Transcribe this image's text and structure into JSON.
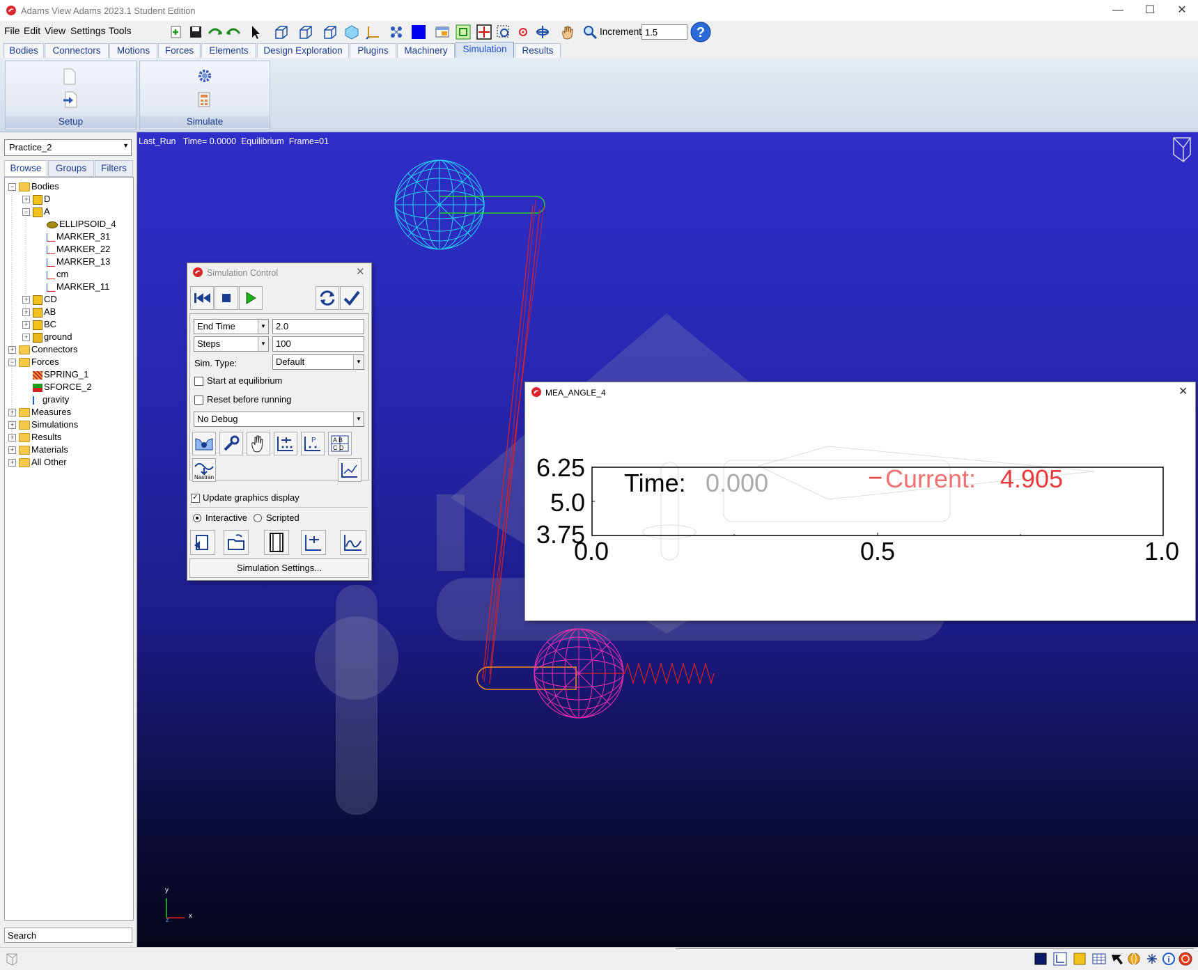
{
  "window": {
    "title": "Adams  View Adams 2023.1 Student Edition",
    "controls": [
      "—",
      "☐",
      "✕"
    ]
  },
  "menu": [
    "File",
    "Edit",
    "View",
    "Settings",
    "Tools"
  ],
  "toolbar": {
    "increment_label": "Increment",
    "increment_value": "1.5"
  },
  "ribbon_tabs": [
    "Bodies",
    "Connectors",
    "Motions",
    "Forces",
    "Elements",
    "Design Exploration",
    "Plugins",
    "Machinery",
    "Simulation",
    "Results"
  ],
  "active_tab": "Simulation",
  "ribbon_groups": [
    "Setup",
    "Simulate"
  ],
  "left_panel": {
    "model": "Practice_2",
    "tabs": [
      "Browse",
      "Groups",
      "Filters"
    ],
    "tree": [
      {
        "label": "Bodies",
        "icon": "folder",
        "level": 0,
        "expanded": true
      },
      {
        "label": "D",
        "icon": "part",
        "level": 1,
        "expanded": false
      },
      {
        "label": "A",
        "icon": "part",
        "level": 1,
        "expanded": true
      },
      {
        "label": "ELLIPSOID_4",
        "icon": "ellipsoid",
        "level": 2
      },
      {
        "label": "MARKER_31",
        "icon": "marker",
        "level": 2
      },
      {
        "label": "MARKER_22",
        "icon": "marker",
        "level": 2
      },
      {
        "label": "MARKER_13",
        "icon": "marker",
        "level": 2
      },
      {
        "label": "cm",
        "icon": "marker",
        "level": 2
      },
      {
        "label": "MARKER_11",
        "icon": "marker",
        "level": 2
      },
      {
        "label": "CD",
        "icon": "part",
        "level": 1,
        "expanded": false
      },
      {
        "label": "AB",
        "icon": "part",
        "level": 1,
        "expanded": false
      },
      {
        "label": "BC",
        "icon": "part",
        "level": 1,
        "expanded": false
      },
      {
        "label": "ground",
        "icon": "ground",
        "level": 1,
        "expanded": false
      },
      {
        "label": "Connectors",
        "icon": "folder",
        "level": 0,
        "expanded": false
      },
      {
        "label": "Forces",
        "icon": "folder",
        "level": 0,
        "expanded": true
      },
      {
        "label": "SPRING_1",
        "icon": "spring",
        "level": 1
      },
      {
        "label": "SFORCE_2",
        "icon": "sforce",
        "level": 1
      },
      {
        "label": "gravity",
        "icon": "gravity",
        "level": 1
      },
      {
        "label": "Measures",
        "icon": "folder",
        "level": 0,
        "expanded": false
      },
      {
        "label": "Simulations",
        "icon": "folder",
        "level": 0,
        "expanded": false
      },
      {
        "label": "Results",
        "icon": "folder",
        "level": 0,
        "expanded": false
      },
      {
        "label": "Materials",
        "icon": "folder",
        "level": 0,
        "expanded": false
      },
      {
        "label": "All Other",
        "icon": "folder",
        "level": 0,
        "expanded": false
      }
    ],
    "search_placeholder": "Search"
  },
  "viewport": {
    "info": "Last_Run   Time= 0.0000  Equilibrium  Frame=01",
    "triad_y": "y",
    "triad_x": "x",
    "triad_z": "z"
  },
  "sim_control": {
    "title": "Simulation Control",
    "end_mode": "End Time",
    "end_value": "2.0",
    "steps_mode": "Steps",
    "steps_value": "100",
    "sim_type_label": "Sim. Type:",
    "sim_type": "Default",
    "start_eq": "Start at equilibrium",
    "reset": "Reset before running",
    "debug": "No Debug",
    "nastran": "Nastran",
    "update_graphics": "Update graphics display",
    "interactive": "Interactive",
    "scripted": "Scripted",
    "settings_btn": "Simulation Settings..."
  },
  "mea_plot": {
    "title": "MEA_ANGLE_4",
    "time_label": "Time:",
    "time_value": "0.000",
    "current_label": "Current:",
    "current_value": "4.905",
    "y_ticks": [
      "6.25",
      "5.0",
      "3.75"
    ],
    "x_ticks": [
      "0.0",
      "0.5",
      "1.0"
    ],
    "colors": {
      "current": "#e83a3a",
      "time_value": "#aaaaaa"
    }
  }
}
